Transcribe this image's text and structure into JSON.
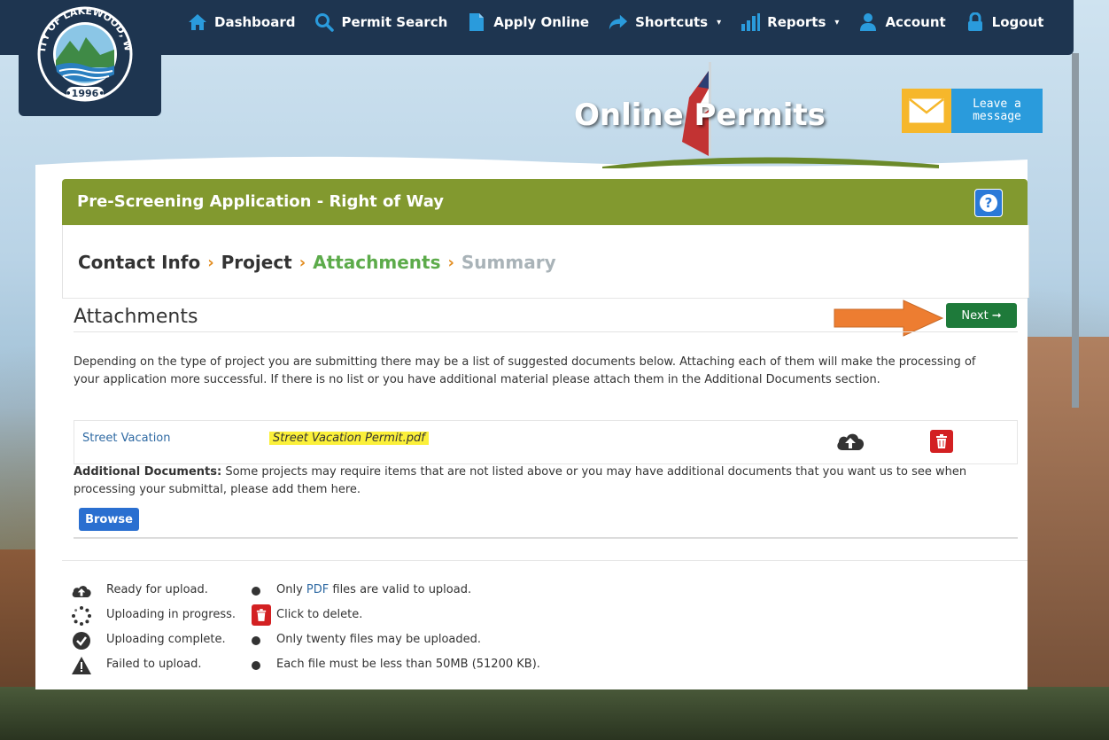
{
  "nav": {
    "items": [
      {
        "label": "Dashboard",
        "icon": "home-icon"
      },
      {
        "label": "Permit Search",
        "icon": "search-icon"
      },
      {
        "label": "Apply Online",
        "icon": "document-icon"
      },
      {
        "label": "Shortcuts",
        "icon": "share-arrow-icon",
        "dropdown": true
      },
      {
        "label": "Reports",
        "icon": "bar-chart-icon",
        "dropdown": true
      },
      {
        "label": "Account",
        "icon": "user-icon"
      },
      {
        "label": "Logout",
        "icon": "lock-icon"
      }
    ]
  },
  "logo": {
    "top_text": "CITY OF LAKEWOOD, WA",
    "year": "•1996•"
  },
  "site_title": "Online Permits",
  "leave_message": "Leave a message",
  "app": {
    "title": "Pre-Screening Application - Right of Way",
    "steps": [
      {
        "label": "Contact Info",
        "state": "done"
      },
      {
        "label": "Project",
        "state": "done"
      },
      {
        "label": "Attachments",
        "state": "current"
      },
      {
        "label": "Summary",
        "state": "future"
      }
    ]
  },
  "attachments": {
    "heading": "Attachments",
    "next_label": "Next",
    "intro": "Depending on the type of project you are submitting there may be a list of suggested documents below. Attaching each of them will make the processing of your application more successful. If there is no list or you have additional material please attach them in the Additional Documents section.",
    "rows": [
      {
        "name": "Street Vacation",
        "file": "Street Vacation Permit.pdf"
      }
    ],
    "additional_label": "Additional Documents:",
    "additional_text": " Some projects may require items that are not listed above or you may have additional documents that you want us to see when processing your submittal, please add them here.",
    "browse_label": "Browse"
  },
  "legend": {
    "ready": "Ready for upload.",
    "uploading": "Uploading in progress.",
    "complete": "Uploading complete.",
    "failed": "Failed to upload.",
    "only_pre": "Only ",
    "only_pdf": "PDF",
    "only_post": " files are valid to upload.",
    "click_delete": "Click to delete.",
    "twenty": "Only twenty files may be uploaded.",
    "size": "Each file must be less than 50MB (51200 KB)."
  },
  "colors": {
    "navy": "#1e3550",
    "olive_header": "#82992f",
    "step_current": "#5cab4a",
    "next_green": "#1e7a3a",
    "delete_red": "#d32022",
    "highlight": "#fbf03a",
    "annotation_arrow": "#ed7d31"
  }
}
